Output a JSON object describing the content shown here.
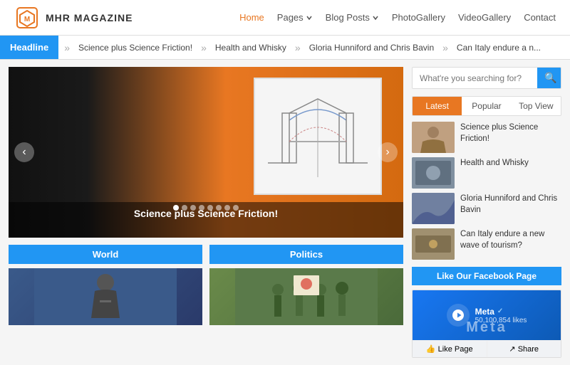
{
  "header": {
    "logo_text": "MHR MAGAZINE",
    "nav": {
      "home": "Home",
      "pages": "Pages",
      "blog_posts": "Blog Posts",
      "photo_gallery": "PhotoGallery",
      "video_gallery": "VideoGallery",
      "contact": "Contact"
    }
  },
  "headline": {
    "label": "Headline",
    "items": [
      "Science plus Science Friction!",
      "Health and Whisky",
      "Gloria Hunniford and Chris Bavin",
      "Can Italy endure a n..."
    ]
  },
  "slider": {
    "caption": "Science plus Science Friction!",
    "dots": 8
  },
  "categories": [
    {
      "id": "world",
      "label": "World"
    },
    {
      "id": "politics",
      "label": "Politics"
    }
  ],
  "sidebar": {
    "search_placeholder": "What're you searching for?",
    "tabs": [
      "Latest",
      "Popular",
      "Top View"
    ],
    "active_tab": 0,
    "news_items": [
      {
        "id": 1,
        "title": "Science plus Science Friction!"
      },
      {
        "id": 2,
        "title": "Health and Whisky"
      },
      {
        "id": 3,
        "title": "Gloria Hunniford and Chris Bavin"
      },
      {
        "id": 4,
        "title": "Can Italy endure a new wave of tourism?"
      }
    ],
    "facebook": {
      "header": "Like Our Facebook Page",
      "page_name": "Meta",
      "verified": "✓",
      "followers": "50,100,854 likes",
      "banner": "Meta",
      "like_label": "👍 Like Page",
      "share_label": "↗ Share"
    }
  }
}
